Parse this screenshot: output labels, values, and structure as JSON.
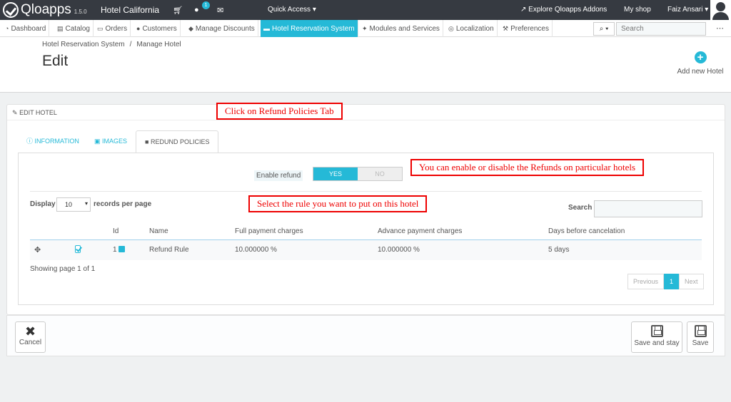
{
  "header": {
    "brand": "Qloapps",
    "version": "1.5.0",
    "shop_name": "Hotel California",
    "notification_count": "1",
    "quick_access": "Quick Access",
    "explore": "Explore Qloapps Addons",
    "my_shop": "My shop",
    "user": "Faiz Ansari"
  },
  "nav": {
    "items": [
      {
        "label": "Dashboard",
        "icon": "dashboard-icon"
      },
      {
        "label": "Catalog",
        "icon": "book-icon"
      },
      {
        "label": "Orders",
        "icon": "credit-card-icon"
      },
      {
        "label": "Customers",
        "icon": "users-icon"
      },
      {
        "label": "Manage Discounts",
        "icon": "tag-icon"
      },
      {
        "label": "Hotel Reservation System",
        "icon": "bed-icon"
      },
      {
        "label": "Modules and Services",
        "icon": "puzzle-icon"
      },
      {
        "label": "Localization",
        "icon": "globe-icon"
      },
      {
        "label": "Preferences",
        "icon": "wrench-icon"
      }
    ],
    "active_index": 5,
    "search_placeholder": "Search"
  },
  "page": {
    "breadcrumb": [
      "Hotel Reservation System",
      "Manage Hotel"
    ],
    "title": "Edit",
    "add_new": "Add new Hotel"
  },
  "panel": {
    "heading": "Edit Hotel",
    "tabs": [
      "Information",
      "Images",
      "Redund Policies"
    ],
    "active_tab": 2,
    "enable_refund_label": "Enable refund",
    "toggle_yes": "YES",
    "toggle_no": "NO",
    "toggle_state": "YES",
    "display_label": "Display",
    "per_page": "10",
    "records_label": "records per page",
    "search_label": "Search",
    "table": {
      "columns": [
        "",
        "",
        "Id",
        "Name",
        "Full payment charges",
        "Advance payment charges",
        "Days before cancelation"
      ],
      "rows": [
        {
          "id": "1",
          "name": "Refund Rule",
          "full": "10.000000 %",
          "advance": "10.000000 %",
          "days": "5 days",
          "checked": true
        }
      ]
    },
    "showing": "Showing page 1 of 1",
    "pagination": {
      "previous": "Previous",
      "current": "1",
      "next": "Next"
    }
  },
  "footer": {
    "cancel": "Cancel",
    "save_and_stay": "Save and stay",
    "save": "Save"
  },
  "annotations": {
    "tab_hint": "Click on Refund Policies Tab",
    "toggle_hint": "You can enable or disable the Refunds on particular hotels",
    "rule_hint": "Select the rule you want to put on this hotel"
  },
  "colors": {
    "accent": "#25b9d7",
    "header_bg": "#363a41",
    "annotation": "#e00000"
  }
}
